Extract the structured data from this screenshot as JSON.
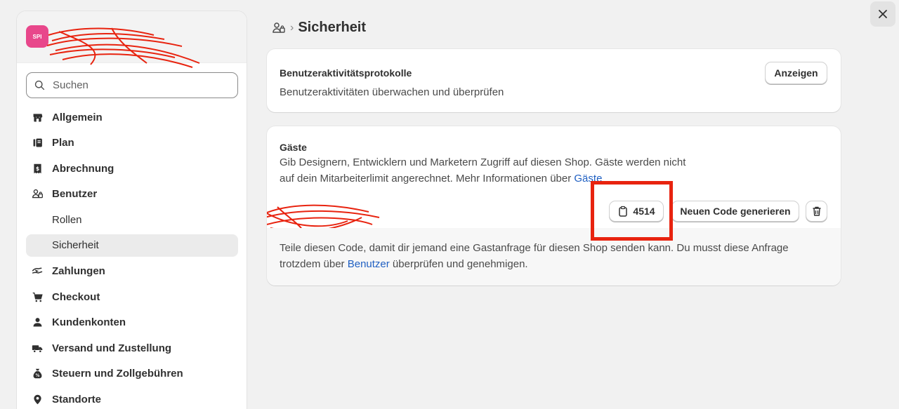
{
  "sidebar": {
    "store_initials": "SPI",
    "search_placeholder": "Suchen",
    "items": [
      {
        "label": "Allgemein",
        "icon": "store-icon"
      },
      {
        "label": "Plan",
        "icon": "plan-icon"
      },
      {
        "label": "Abrechnung",
        "icon": "receipt-icon"
      },
      {
        "label": "Benutzer",
        "icon": "users-icon"
      },
      {
        "label": "Rollen"
      },
      {
        "label": "Sicherheit"
      },
      {
        "label": "Zahlungen",
        "icon": "payments-icon"
      },
      {
        "label": "Checkout",
        "icon": "cart-icon"
      },
      {
        "label": "Kundenkonten",
        "icon": "person-icon"
      },
      {
        "label": "Versand und Zustellung",
        "icon": "truck-icon"
      },
      {
        "label": "Steuern und Zollgebühren",
        "icon": "tax-icon"
      },
      {
        "label": "Standorte",
        "icon": "location-icon"
      }
    ]
  },
  "header": {
    "breadcrumb_sep": "›",
    "title": "Sicherheit"
  },
  "activity_card": {
    "title": "Benutzeraktivitätsprotokolle",
    "description": "Benutzeraktivitäten überwachen und überprüfen",
    "button": "Anzeigen"
  },
  "guests_card": {
    "title": "Gäste",
    "description_line1": "Gib Designern, Entwicklern und Marketern Zugriff auf diesen Shop. Gäste werden nicht",
    "description_line2_prefix": "auf dein Mitarbeiterlimit angerechnet. Mehr Informationen über ",
    "description_link": "Gäste",
    "code": "4514",
    "generate_button": "Neuen Code generieren",
    "footer_line1": "Teile diesen Code, damit dir jemand eine Gastanfrage für diesen Shop senden kann. Du musst diese Anfrage",
    "footer_line2_prefix": "trotzdem über ",
    "footer_link": "Benutzer",
    "footer_line2_suffix": " überprüfen und genehmigen."
  },
  "colors": {
    "accent_link": "#1f5fc2",
    "highlight": "#e8230f",
    "avatar": "#e8478b"
  }
}
